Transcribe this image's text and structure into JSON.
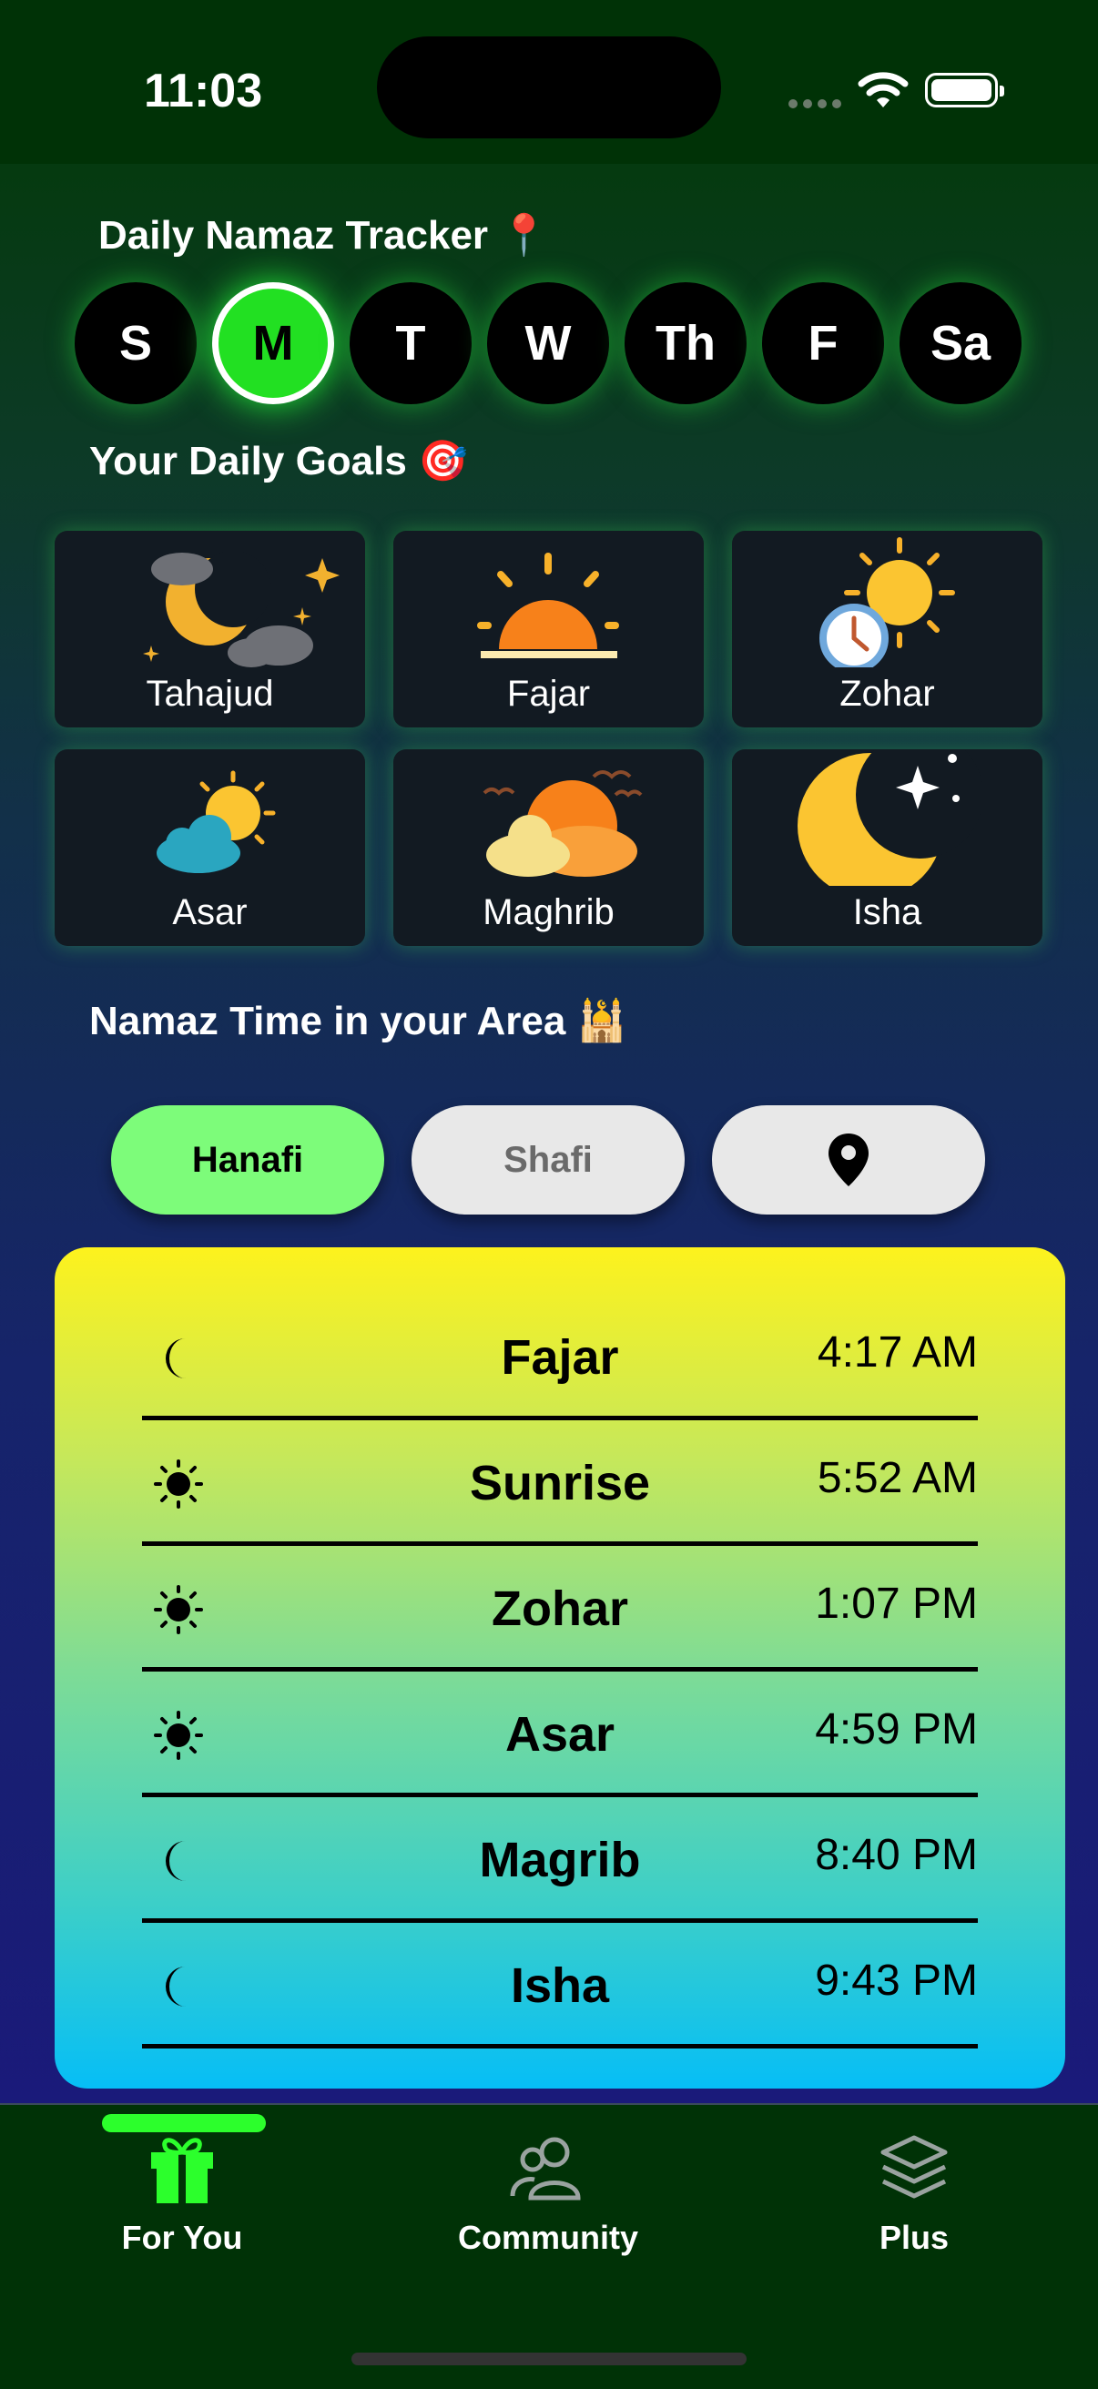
{
  "status_bar": {
    "time": "11:03",
    "icons": [
      "signal-dots-icon",
      "wifi-icon",
      "battery-icon"
    ]
  },
  "tracker": {
    "title": "Daily Namaz Tracker 📍",
    "days": [
      "S",
      "M",
      "T",
      "W",
      "Th",
      "F",
      "Sa"
    ],
    "selected_day": "M"
  },
  "goals": {
    "title": "Your Daily Goals 🎯",
    "items": [
      {
        "label": "Tahajud",
        "icon": "moon-clouds-stars-icon"
      },
      {
        "label": "Fajar",
        "icon": "sunrise-icon"
      },
      {
        "label": "Zohar",
        "icon": "sun-clock-icon"
      },
      {
        "label": "Asar",
        "icon": "sun-behind-cloud-icon"
      },
      {
        "label": "Maghrib",
        "icon": "sunset-clouds-icon"
      },
      {
        "label": "Isha",
        "icon": "crescent-moon-star-icon"
      }
    ]
  },
  "area": {
    "title": "Namaz Time in your Area 🕌",
    "modes": {
      "hanafi": "Hanafi",
      "shafi": "Shafi",
      "location_icon": "location-pin-icon"
    },
    "selected_mode": "Hanafi"
  },
  "prayer_times": [
    {
      "name": "Fajar",
      "time": "4:17 AM",
      "icon": "moon-icon"
    },
    {
      "name": "Sunrise",
      "time": "5:52 AM",
      "icon": "sun-icon"
    },
    {
      "name": "Zohar",
      "time": "1:07 PM",
      "icon": "sun-icon"
    },
    {
      "name": "Asar",
      "time": "4:59 PM",
      "icon": "sun-icon"
    },
    {
      "name": "Magrib",
      "time": "8:40 PM",
      "icon": "moon-icon"
    },
    {
      "name": "Isha",
      "time": "9:43 PM",
      "icon": "moon-icon"
    }
  ],
  "tabs": [
    {
      "label": "For You",
      "icon": "gift-icon",
      "active": true
    },
    {
      "label": "Community",
      "icon": "people-icon",
      "active": false
    },
    {
      "label": "Plus",
      "icon": "layers-icon",
      "active": false
    }
  ],
  "colors": {
    "accent": "#22e022",
    "tab_active": "#2cff2c",
    "card_bg": "#121a22",
    "tabbar_bg": "#003206"
  }
}
